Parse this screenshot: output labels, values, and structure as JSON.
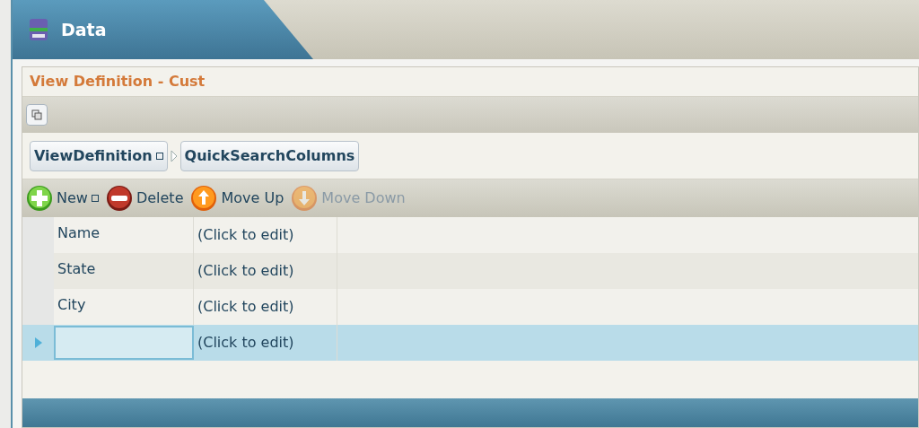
{
  "tab": {
    "title": "Data"
  },
  "panel": {
    "title": "View Definition - Cust"
  },
  "breadcrumb": [
    {
      "label": "ViewDefinition",
      "has_menu": true
    },
    {
      "label": "QuickSearchColumns",
      "has_menu": false
    }
  ],
  "actions": [
    {
      "kind": "add",
      "label": "New",
      "has_menu": true,
      "disabled": false
    },
    {
      "kind": "delete",
      "label": "Delete",
      "has_menu": false,
      "disabled": false
    },
    {
      "kind": "up",
      "label": "Move Up",
      "has_menu": false,
      "disabled": false
    },
    {
      "kind": "down",
      "label": "Move Down",
      "has_menu": false,
      "disabled": true
    }
  ],
  "rows": [
    {
      "name": "Name",
      "value": "(Click to edit)",
      "selected": false
    },
    {
      "name": "State",
      "value": "(Click to edit)",
      "selected": false
    },
    {
      "name": "City",
      "value": "(Click to edit)",
      "selected": false
    },
    {
      "name": "",
      "value": "(Click to edit)",
      "selected": true
    }
  ]
}
